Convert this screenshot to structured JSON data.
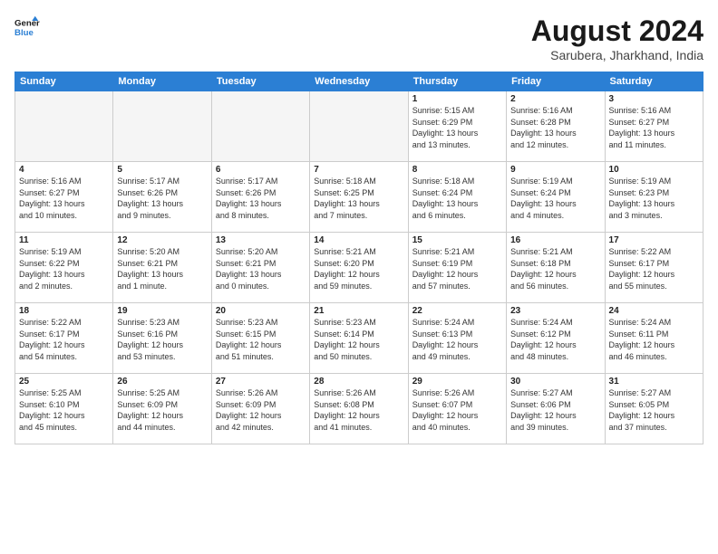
{
  "header": {
    "logo_line1": "General",
    "logo_line2": "Blue",
    "main_title": "August 2024",
    "subtitle": "Sarubera, Jharkhand, India"
  },
  "days_of_week": [
    "Sunday",
    "Monday",
    "Tuesday",
    "Wednesday",
    "Thursday",
    "Friday",
    "Saturday"
  ],
  "weeks": [
    [
      {
        "num": "",
        "info": "",
        "empty": true
      },
      {
        "num": "",
        "info": "",
        "empty": true
      },
      {
        "num": "",
        "info": "",
        "empty": true
      },
      {
        "num": "",
        "info": "",
        "empty": true
      },
      {
        "num": "1",
        "info": "Sunrise: 5:15 AM\nSunset: 6:29 PM\nDaylight: 13 hours\nand 13 minutes."
      },
      {
        "num": "2",
        "info": "Sunrise: 5:16 AM\nSunset: 6:28 PM\nDaylight: 13 hours\nand 12 minutes."
      },
      {
        "num": "3",
        "info": "Sunrise: 5:16 AM\nSunset: 6:27 PM\nDaylight: 13 hours\nand 11 minutes."
      }
    ],
    [
      {
        "num": "4",
        "info": "Sunrise: 5:16 AM\nSunset: 6:27 PM\nDaylight: 13 hours\nand 10 minutes."
      },
      {
        "num": "5",
        "info": "Sunrise: 5:17 AM\nSunset: 6:26 PM\nDaylight: 13 hours\nand 9 minutes."
      },
      {
        "num": "6",
        "info": "Sunrise: 5:17 AM\nSunset: 6:26 PM\nDaylight: 13 hours\nand 8 minutes."
      },
      {
        "num": "7",
        "info": "Sunrise: 5:18 AM\nSunset: 6:25 PM\nDaylight: 13 hours\nand 7 minutes."
      },
      {
        "num": "8",
        "info": "Sunrise: 5:18 AM\nSunset: 6:24 PM\nDaylight: 13 hours\nand 6 minutes."
      },
      {
        "num": "9",
        "info": "Sunrise: 5:19 AM\nSunset: 6:24 PM\nDaylight: 13 hours\nand 4 minutes."
      },
      {
        "num": "10",
        "info": "Sunrise: 5:19 AM\nSunset: 6:23 PM\nDaylight: 13 hours\nand 3 minutes."
      }
    ],
    [
      {
        "num": "11",
        "info": "Sunrise: 5:19 AM\nSunset: 6:22 PM\nDaylight: 13 hours\nand 2 minutes."
      },
      {
        "num": "12",
        "info": "Sunrise: 5:20 AM\nSunset: 6:21 PM\nDaylight: 13 hours\nand 1 minute."
      },
      {
        "num": "13",
        "info": "Sunrise: 5:20 AM\nSunset: 6:21 PM\nDaylight: 13 hours\nand 0 minutes."
      },
      {
        "num": "14",
        "info": "Sunrise: 5:21 AM\nSunset: 6:20 PM\nDaylight: 12 hours\nand 59 minutes."
      },
      {
        "num": "15",
        "info": "Sunrise: 5:21 AM\nSunset: 6:19 PM\nDaylight: 12 hours\nand 57 minutes."
      },
      {
        "num": "16",
        "info": "Sunrise: 5:21 AM\nSunset: 6:18 PM\nDaylight: 12 hours\nand 56 minutes."
      },
      {
        "num": "17",
        "info": "Sunrise: 5:22 AM\nSunset: 6:17 PM\nDaylight: 12 hours\nand 55 minutes."
      }
    ],
    [
      {
        "num": "18",
        "info": "Sunrise: 5:22 AM\nSunset: 6:17 PM\nDaylight: 12 hours\nand 54 minutes."
      },
      {
        "num": "19",
        "info": "Sunrise: 5:23 AM\nSunset: 6:16 PM\nDaylight: 12 hours\nand 53 minutes."
      },
      {
        "num": "20",
        "info": "Sunrise: 5:23 AM\nSunset: 6:15 PM\nDaylight: 12 hours\nand 51 minutes."
      },
      {
        "num": "21",
        "info": "Sunrise: 5:23 AM\nSunset: 6:14 PM\nDaylight: 12 hours\nand 50 minutes."
      },
      {
        "num": "22",
        "info": "Sunrise: 5:24 AM\nSunset: 6:13 PM\nDaylight: 12 hours\nand 49 minutes."
      },
      {
        "num": "23",
        "info": "Sunrise: 5:24 AM\nSunset: 6:12 PM\nDaylight: 12 hours\nand 48 minutes."
      },
      {
        "num": "24",
        "info": "Sunrise: 5:24 AM\nSunset: 6:11 PM\nDaylight: 12 hours\nand 46 minutes."
      }
    ],
    [
      {
        "num": "25",
        "info": "Sunrise: 5:25 AM\nSunset: 6:10 PM\nDaylight: 12 hours\nand 45 minutes."
      },
      {
        "num": "26",
        "info": "Sunrise: 5:25 AM\nSunset: 6:09 PM\nDaylight: 12 hours\nand 44 minutes."
      },
      {
        "num": "27",
        "info": "Sunrise: 5:26 AM\nSunset: 6:09 PM\nDaylight: 12 hours\nand 42 minutes."
      },
      {
        "num": "28",
        "info": "Sunrise: 5:26 AM\nSunset: 6:08 PM\nDaylight: 12 hours\nand 41 minutes."
      },
      {
        "num": "29",
        "info": "Sunrise: 5:26 AM\nSunset: 6:07 PM\nDaylight: 12 hours\nand 40 minutes."
      },
      {
        "num": "30",
        "info": "Sunrise: 5:27 AM\nSunset: 6:06 PM\nDaylight: 12 hours\nand 39 minutes."
      },
      {
        "num": "31",
        "info": "Sunrise: 5:27 AM\nSunset: 6:05 PM\nDaylight: 12 hours\nand 37 minutes."
      }
    ]
  ]
}
